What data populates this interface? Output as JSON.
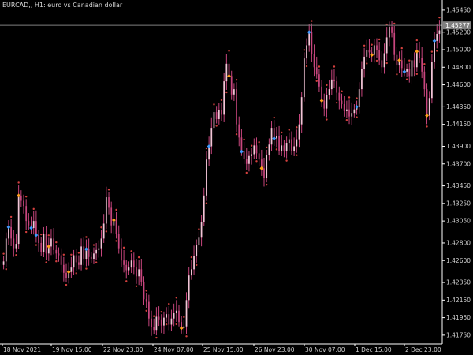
{
  "chart_title": "EURCAD,, H1:  euro vs Canadian dollar",
  "colors": {
    "background": "#000000",
    "axis": "#ffffff",
    "candle": "#f2c4d6",
    "candle_dark": "#c8467e",
    "marker_dot": "#d4403e",
    "signal_orange": "#ff9f1a",
    "signal_blue": "#3f9bff",
    "current_price_line": "#7f7f7f",
    "current_price_label_bg": "#808080"
  },
  "chart_data": {
    "type": "candlestick",
    "title": "EURCAD,, H1:  euro vs Canadian dollar",
    "ylim": [
      1.4165,
      1.4553
    ],
    "y_ticks": [
      "1.45450",
      "1.45200",
      "1.45000",
      "1.44800",
      "1.44600",
      "1.44350",
      "1.44150",
      "1.43900",
      "1.43700",
      "1.43450",
      "1.43250",
      "1.43050",
      "1.42800",
      "1.42600",
      "1.42350",
      "1.42150",
      "1.41950",
      "1.41750"
    ],
    "x_ticks": [
      "18 Nov 2021",
      "19 Nov 15:00",
      "22 Nov 23:00",
      "24 Nov 07:00",
      "25 Nov 15:00",
      "26 Nov 23:00",
      "30 Nov 07:00",
      "1 Dec 15:00",
      "2 Dec 23:00"
    ],
    "current_price": "1.45277",
    "close_series": [
      1.4259,
      1.4285,
      1.4298,
      1.4285,
      1.4274,
      1.4279,
      1.4334,
      1.4328,
      1.4322,
      1.4305,
      1.43,
      1.4297,
      1.4305,
      1.4289,
      1.428,
      1.427,
      1.429,
      1.4268,
      1.4276,
      1.4285,
      1.4272,
      1.4268,
      1.4266,
      1.4255,
      1.4246,
      1.424,
      1.4247,
      1.4252,
      1.4266,
      1.4258,
      1.4255,
      1.4276,
      1.4262,
      1.4273,
      1.4264,
      1.4262,
      1.4268,
      1.4272,
      1.4274,
      1.4285,
      1.4302,
      1.4332,
      1.432,
      1.43,
      1.4306,
      1.429,
      1.4274,
      1.426,
      1.4255,
      1.4249,
      1.4252,
      1.426,
      1.4252,
      1.4242,
      1.425,
      1.4236,
      1.4216,
      1.4213,
      1.4194,
      1.4184,
      1.4181,
      1.4196,
      1.4193,
      1.4186,
      1.4195,
      1.4199,
      1.4187,
      1.4194,
      1.42,
      1.4203,
      1.419,
      1.4183,
      1.4185,
      1.4215,
      1.4243,
      1.425,
      1.4265,
      1.4278,
      1.4286,
      1.4304,
      1.4334,
      1.4375,
      1.439,
      1.4411,
      1.4429,
      1.4421,
      1.4431,
      1.4426,
      1.4464,
      1.4484,
      1.447,
      1.4449,
      1.4455,
      1.4415,
      1.44,
      1.4384,
      1.4376,
      1.437,
      1.4379,
      1.4381,
      1.4391,
      1.4382,
      1.4375,
      1.4365,
      1.4354,
      1.438,
      1.4392,
      1.4411,
      1.4399,
      1.4402,
      1.4385,
      1.4391,
      1.4385,
      1.4394,
      1.4398,
      1.4385,
      1.439,
      1.4398,
      1.4415,
      1.4446,
      1.449,
      1.4505,
      1.452,
      1.4495,
      1.448,
      1.4472,
      1.4458,
      1.4442,
      1.4433,
      1.4448,
      1.4455,
      1.4466,
      1.4464,
      1.4451,
      1.4442,
      1.4438,
      1.443,
      1.4432,
      1.4424,
      1.4428,
      1.4432,
      1.4435,
      1.4455,
      1.4478,
      1.4492,
      1.45,
      1.4497,
      1.4494,
      1.4505,
      1.45,
      1.4488,
      1.448,
      1.4496,
      1.4514,
      1.4526,
      1.4519,
      1.4494,
      1.4482,
      1.4488,
      1.4479,
      1.4475,
      1.4478,
      1.447,
      1.4488,
      1.448,
      1.4498,
      1.4491,
      1.4475,
      1.4455,
      1.4425,
      1.4445,
      1.4486,
      1.451,
      1.4518,
      1.4522
    ],
    "signals": {
      "blue_indices": [
        2,
        11,
        13,
        33,
        82,
        95,
        108,
        122,
        141,
        160,
        172,
        175
      ],
      "orange_indices": [
        6,
        18,
        26,
        44,
        71,
        90,
        103,
        127,
        147,
        158,
        165,
        169
      ]
    }
  }
}
